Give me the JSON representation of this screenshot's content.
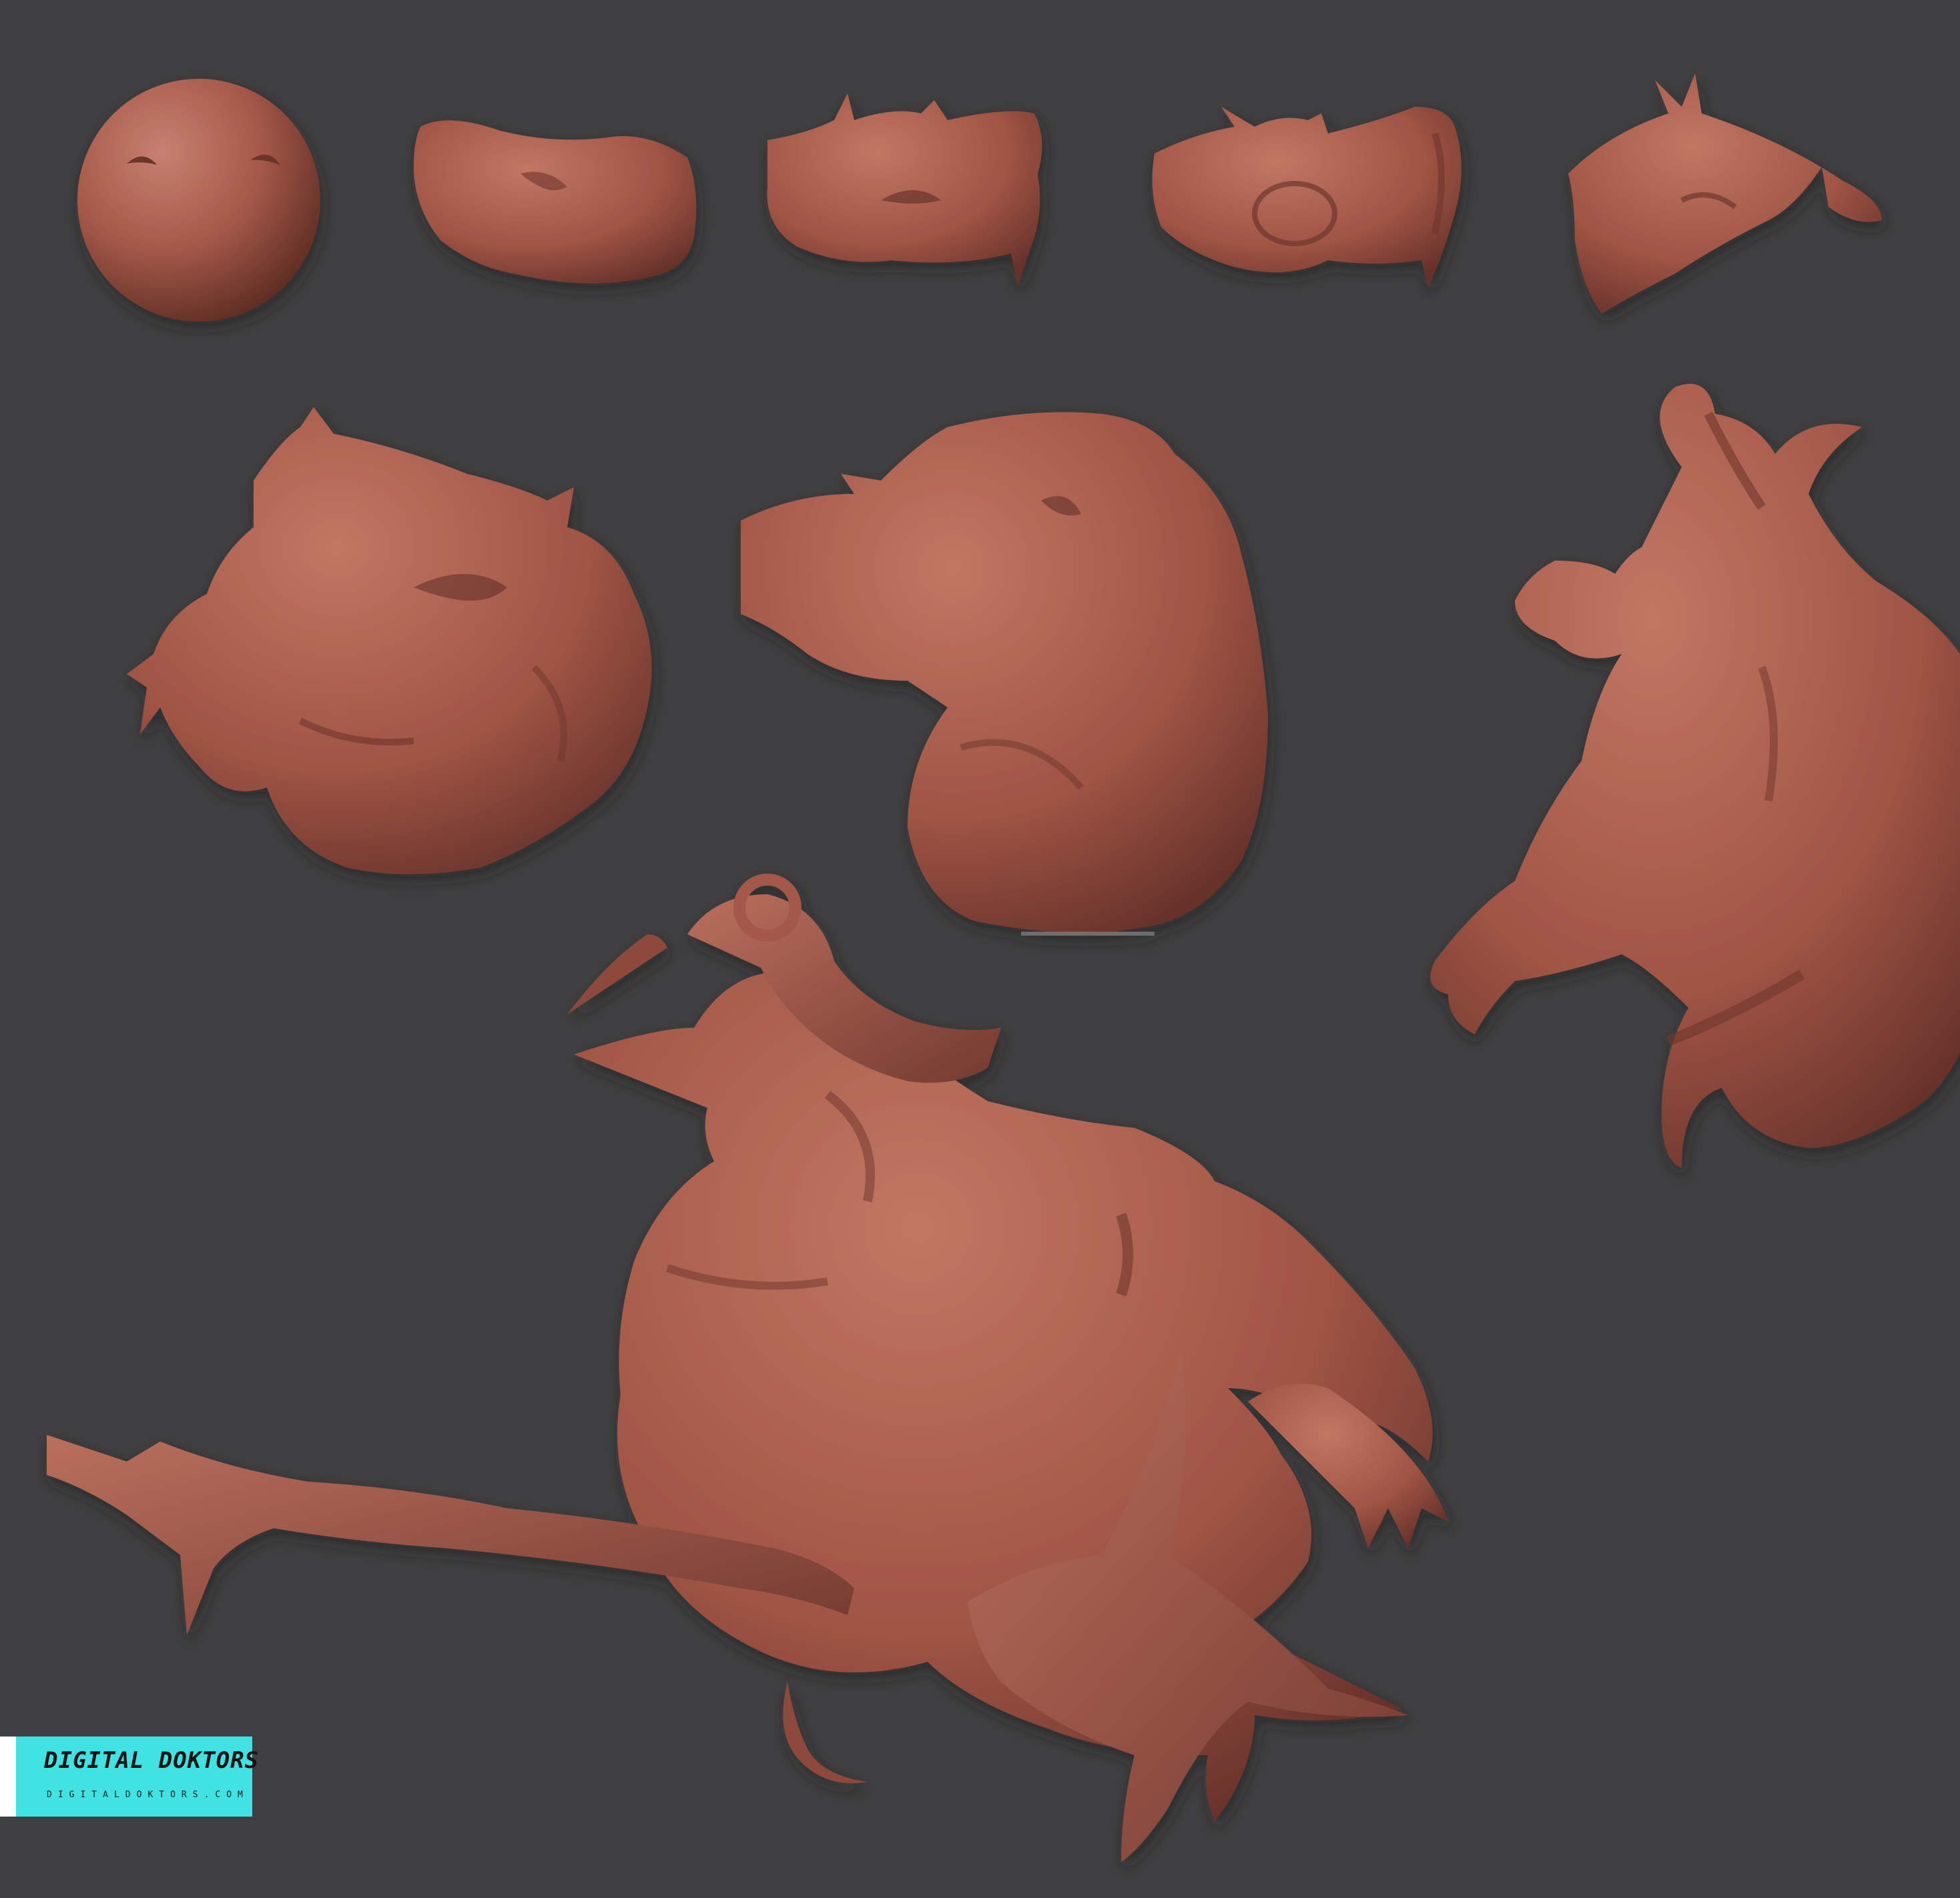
{
  "colors": {
    "background": "#3f3f41",
    "clay": "#a45848",
    "clay_light": "#c07462",
    "clay_dark": "#6e362c",
    "logo_bg": "#41e2e2"
  },
  "logo": {
    "brand": "DIGITAL DOKTORS",
    "url": "DIGITALDOKTORS.COM"
  }
}
